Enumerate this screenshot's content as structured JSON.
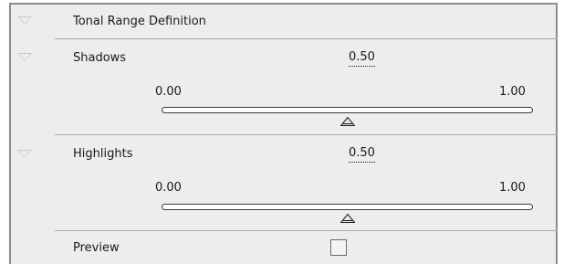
{
  "sections": {
    "tonal_range": {
      "title": "Tonal Range Definition"
    },
    "shadows": {
      "label": "Shadows",
      "value": "0.50",
      "min_label": "0.00",
      "max_label": "1.00",
      "slider_position": 0.5
    },
    "highlights": {
      "label": "Highlights",
      "value": "0.50",
      "min_label": "0.00",
      "max_label": "1.00",
      "slider_position": 0.5
    },
    "preview": {
      "label": "Preview",
      "checked": false
    }
  },
  "icons": {
    "twirl": "disclosure-triangle-down-icon",
    "thumb": "slider-triangle-thumb-icon"
  },
  "colors": {
    "panel_bg": "#ededed",
    "frame": "#8c8c8c",
    "divider": "#a8a8a8",
    "text": "#1a1a1a"
  }
}
